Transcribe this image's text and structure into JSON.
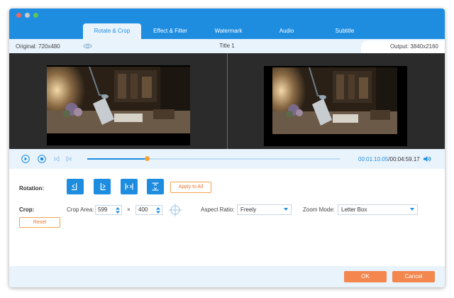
{
  "tabs": [
    {
      "label": "Rotate & Crop",
      "active": true
    },
    {
      "label": "Effect & Filter",
      "active": false
    },
    {
      "label": "Watermark",
      "active": false
    },
    {
      "label": "Audio",
      "active": false
    },
    {
      "label": "Subtitle",
      "active": false
    }
  ],
  "info": {
    "original": "Original: 720x480",
    "title": "Title 1",
    "output": "Output: 3840x2160"
  },
  "playback": {
    "current_time": "00:01:10.05",
    "total_time": "/00:04:59.17",
    "progress": 0.237
  },
  "rotation": {
    "label": "Rotation:",
    "apply_all": "Apply to All"
  },
  "crop": {
    "label": "Crop:",
    "area_label": "Crop Area:",
    "width": "599",
    "times": "×",
    "height": "400",
    "aspect_label": "Aspect Ratio:",
    "aspect_value": "Freely",
    "zoom_label": "Zoom Mode:",
    "zoom_value": "Letter Box",
    "reset": "Reset"
  },
  "footer": {
    "ok": "OK",
    "cancel": "Cancel"
  },
  "colors": {
    "accent": "#1e8de0",
    "orange": "#f4874e",
    "panel": "#e9f3fc"
  }
}
